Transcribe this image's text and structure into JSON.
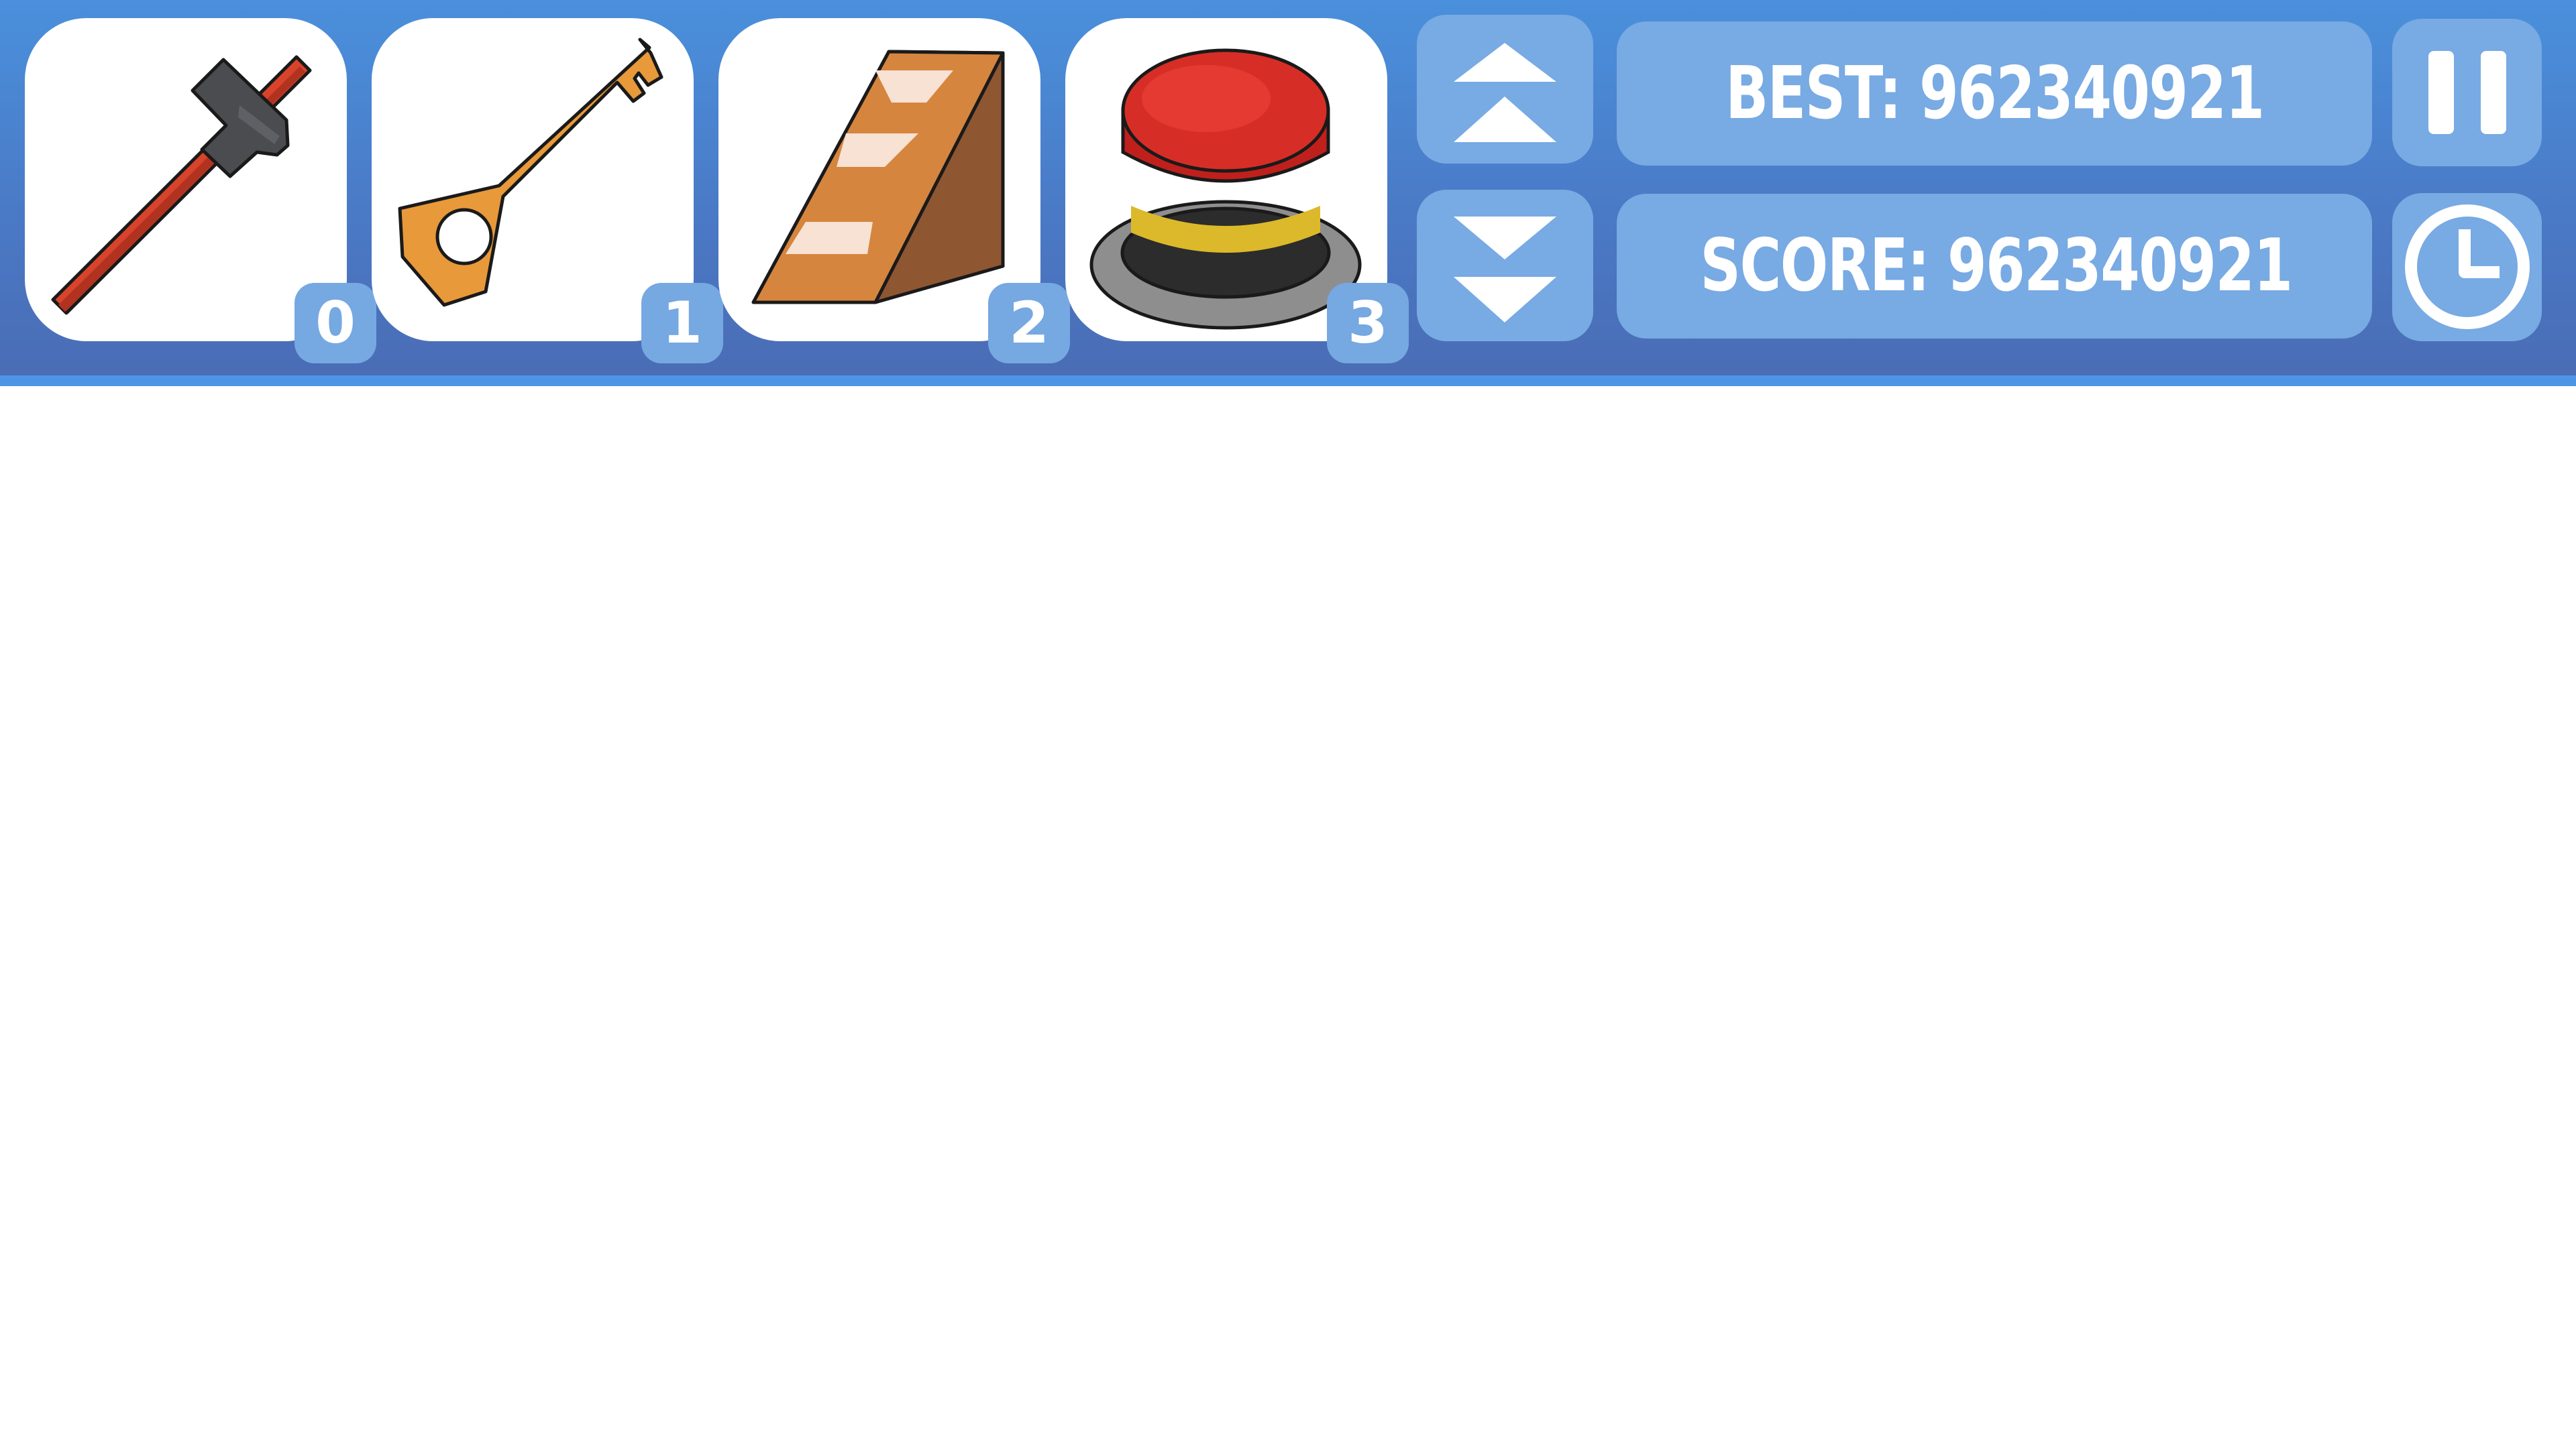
{
  "toolbar": {
    "items": [
      {
        "name": "hammer",
        "icon": "hammer-icon",
        "count": "0"
      },
      {
        "name": "key",
        "icon": "key-icon",
        "count": "1"
      },
      {
        "name": "ramp",
        "icon": "ramp-icon",
        "count": "2"
      },
      {
        "name": "button",
        "icon": "red-push-button-icon",
        "count": "3"
      }
    ],
    "scroll_up_icon": "double-chevron-up-icon",
    "scroll_down_icon": "double-chevron-down-icon"
  },
  "scores": {
    "best_label": "BEST: 962340921",
    "score_label": "SCORE: 962340921"
  },
  "controls": {
    "pause_icon": "pause-icon",
    "timer_icon": "clock-icon"
  },
  "colors": {
    "bar_top": "#4a90dc",
    "bar_bottom": "#4a6cb4",
    "panel": "#78aae3",
    "badge": "#76a8e2"
  }
}
